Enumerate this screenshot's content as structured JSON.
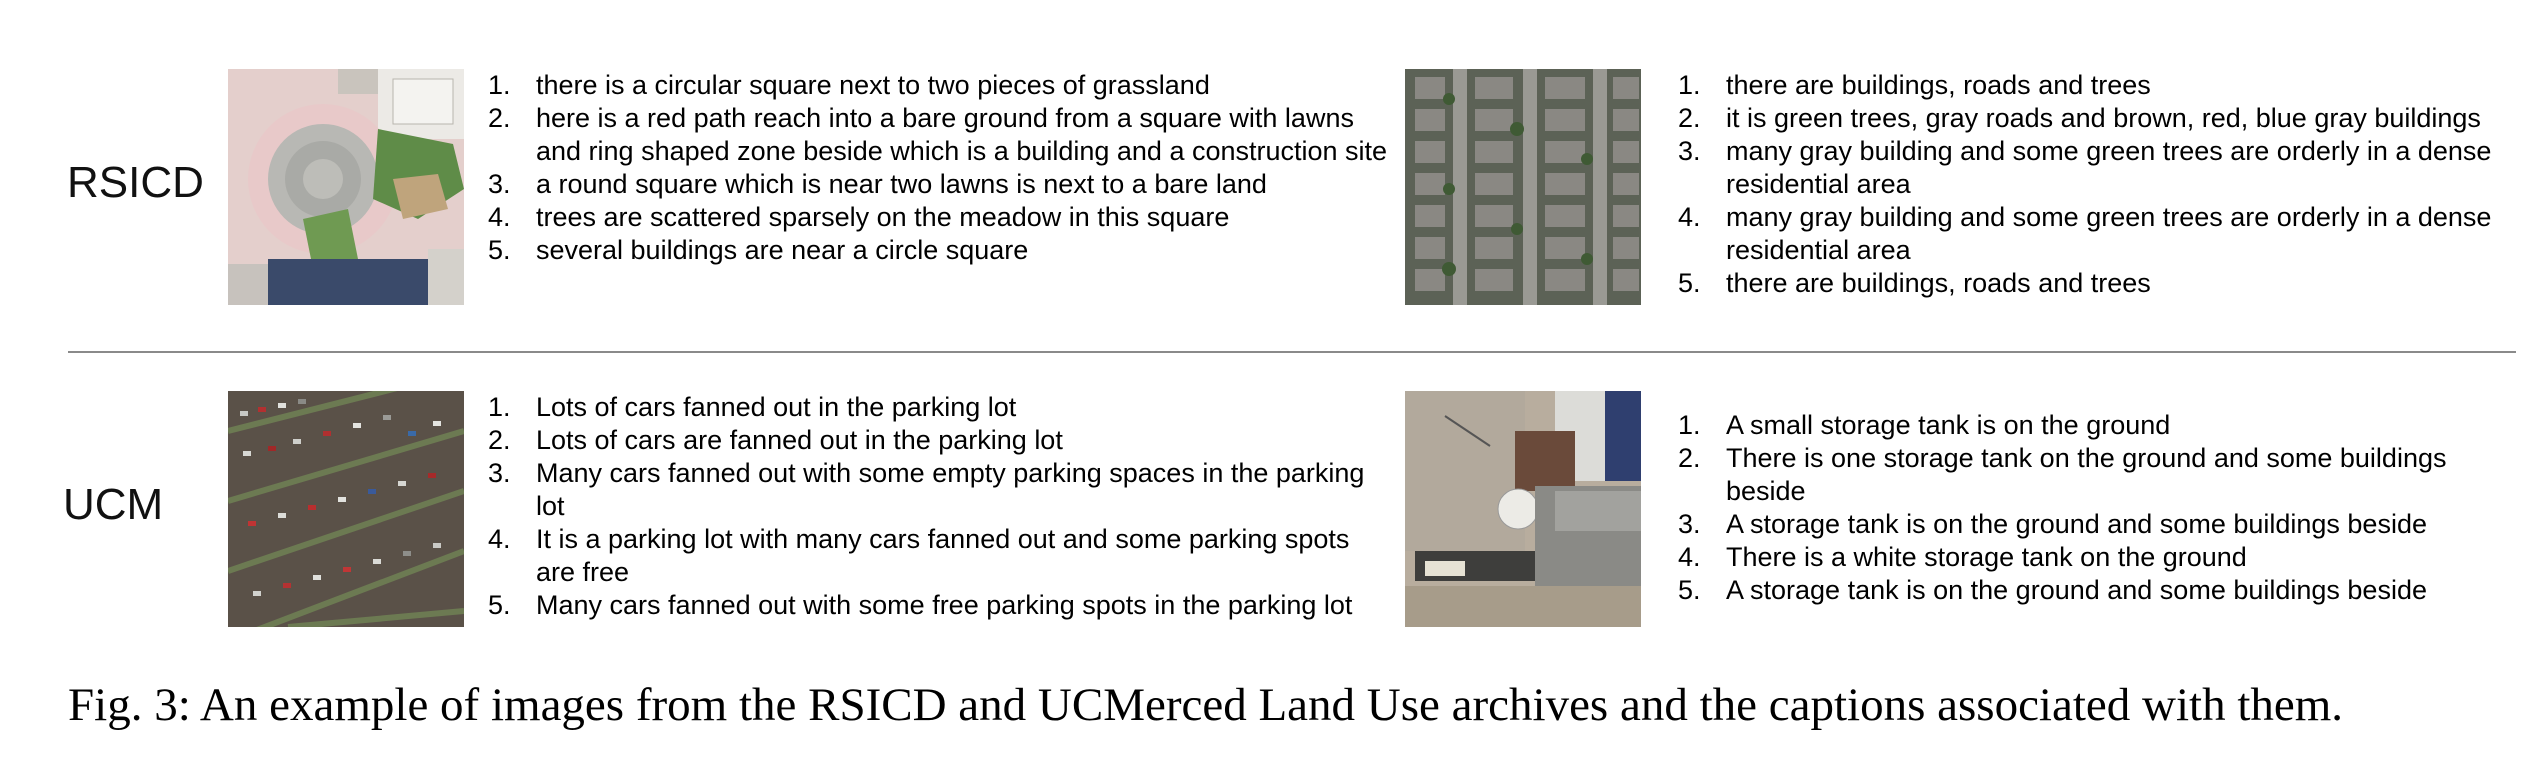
{
  "rows": {
    "rsicd": {
      "label": "RSICD"
    },
    "ucm": {
      "label": "UCM"
    }
  },
  "captions": {
    "rsicd_left": [
      {
        "num": "1.",
        "text": "there is a circular square next to two pieces of grassland"
      },
      {
        "num": "2.",
        "text": "here is a red path reach into a bare ground from a square with lawns and ring shaped zone  beside which is a building and a construction site"
      },
      {
        "num": "3.",
        "text": "a round square which is near two lawns is next to a bare land"
      },
      {
        "num": "4.",
        "text": "trees are scattered sparsely on the meadow in this square"
      },
      {
        "num": "5.",
        "text": "several buildings are near a circle square"
      }
    ],
    "rsicd_right": [
      {
        "num": "1.",
        "text": "there are buildings, roads and trees"
      },
      {
        "num": "2.",
        "text": "it is green trees, gray roads and brown, red, blue gray buildings"
      },
      {
        "num": "3.",
        "text": "many gray building and some green trees are orderly in a dense residential area"
      },
      {
        "num": "4.",
        "text": "many gray building and some green trees are orderly in a dense residential area"
      },
      {
        "num": "5.",
        "text": "there are buildings, roads and trees"
      }
    ],
    "ucm_left": [
      {
        "num": "1.",
        "text": "Lots of cars fanned out in the parking lot"
      },
      {
        "num": "2.",
        "text": "Lots of cars are fanned out in the parking lot"
      },
      {
        "num": "3.",
        "text": "Many cars fanned out with some empty parking spaces in the parking lot"
      },
      {
        "num": "4.",
        "text": "It is a parking lot with many cars fanned out and some parking spots are free"
      },
      {
        "num": "5.",
        "text": "Many cars fanned out with some free parking spots in the parking lot"
      }
    ],
    "ucm_right": [
      {
        "num": "1.",
        "text": "A small storage tank is on the ground"
      },
      {
        "num": "2.",
        "text": "There is one storage tank on the ground and some buildings beside"
      },
      {
        "num": "3.",
        "text": "A storage tank is on the ground and some buildings beside"
      },
      {
        "num": "4.",
        "text": "There is a white storage tank on the ground"
      },
      {
        "num": "5.",
        "text": "A storage tank is on the ground and some buildings beside"
      }
    ]
  },
  "figure_caption": "Fig. 3: An example of images from the RSICD and UCMerced Land Use archives and the captions associated with them."
}
